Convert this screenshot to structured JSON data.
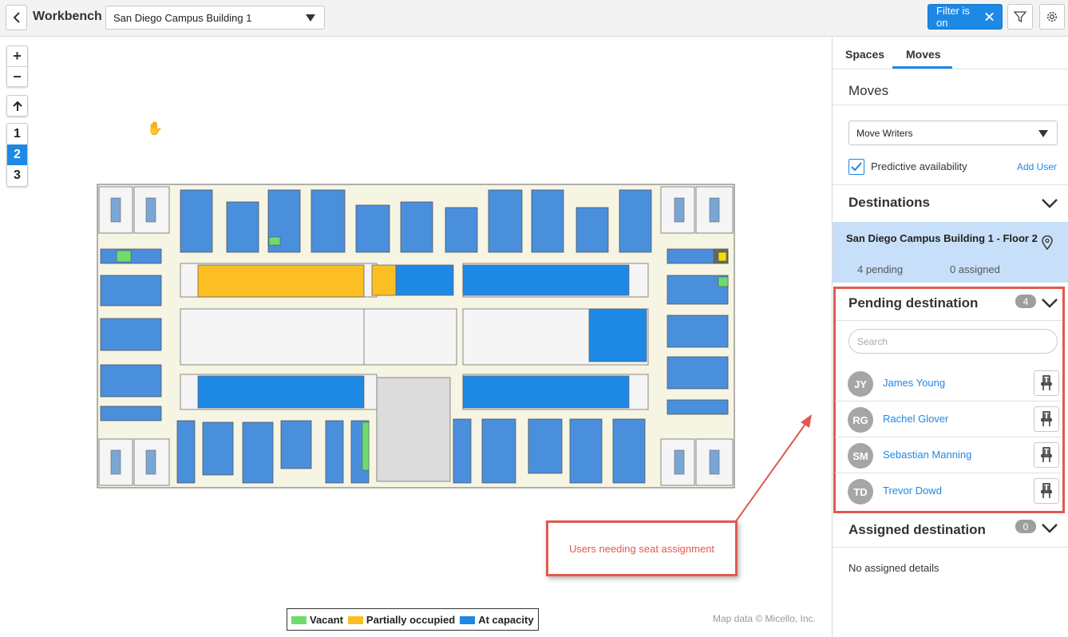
{
  "header": {
    "app_title": "Workbench",
    "building": "San Diego Campus Building 1",
    "filter_label": "Filter is on"
  },
  "map": {
    "floor_buttons": [
      "1",
      "2",
      "3"
    ],
    "active_floor": "2",
    "legend": [
      {
        "label": "Vacant",
        "color": "#6ddc6d"
      },
      {
        "label": "Partially occupied",
        "color": "#fbbf24"
      },
      {
        "label": "At capacity",
        "color": "#1e88e5"
      }
    ],
    "attribution": "Map data © Micello, Inc.",
    "callout": "Users needing seat assignment"
  },
  "panel": {
    "tabs": [
      "Spaces",
      "Moves"
    ],
    "active_tab": "Moves",
    "moves_title": "Moves",
    "moves_select": "Move Writers",
    "predictive_label": "Predictive availability",
    "add_user": "Add User",
    "destinations_title": "Destinations",
    "floor_card": {
      "name": "San Diego Campus Building 1 - Floor 2",
      "pending": "4 pending",
      "assigned": "0 assigned"
    },
    "pending": {
      "title": "Pending destination",
      "count": "4",
      "search_placeholder": "Search",
      "users": [
        {
          "initials": "JY",
          "name": "James Young"
        },
        {
          "initials": "RG",
          "name": "Rachel Glover"
        },
        {
          "initials": "SM",
          "name": "Sebastian Manning"
        },
        {
          "initials": "TD",
          "name": "Trevor Dowd"
        }
      ]
    },
    "assigned": {
      "title": "Assigned destination",
      "count": "0",
      "empty_text": "No assigned details"
    }
  }
}
